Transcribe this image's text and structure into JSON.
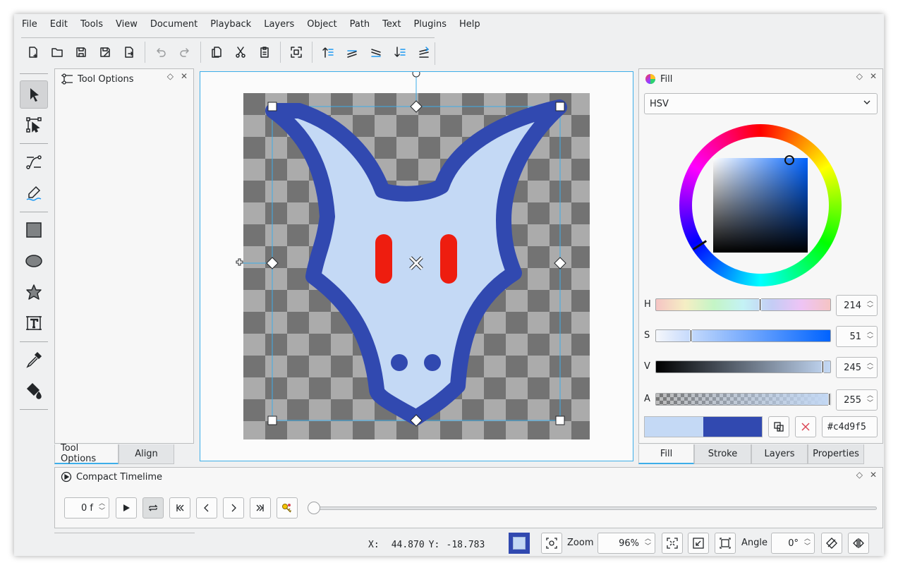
{
  "menu": [
    "File",
    "Edit",
    "Tools",
    "View",
    "Document",
    "Playback",
    "Layers",
    "Object",
    "Path",
    "Text",
    "Plugins",
    "Help"
  ],
  "toolbar_icons": [
    "new-document-icon",
    "open-icon",
    "save-icon",
    "save-as-icon",
    "export-icon",
    "undo-icon",
    "redo-icon",
    "copy-icon",
    "cut-icon",
    "paste-icon",
    "group-icon",
    "raise-to-top-icon",
    "raise-icon",
    "lower-icon",
    "lower-to-bottom-icon",
    "move-to-layer-icon"
  ],
  "tool_options": {
    "title": "Tool Options",
    "tabs": [
      "Tool Options",
      "Align"
    ]
  },
  "fill_panel": {
    "title": "Fill",
    "mode": "HSV",
    "hue_label": "H",
    "hue": "214",
    "sat_label": "S",
    "sat": "51",
    "val_label": "V",
    "val": "245",
    "alpha_label": "A",
    "alpha": "255",
    "hex": "#c4d9f5",
    "fill_color": "#c4d9f5",
    "stroke_color": "#3149b0",
    "tabs": [
      "Fill",
      "Stroke",
      "Layers",
      "Properties"
    ]
  },
  "timeline": {
    "title": "Compact Timelime",
    "frame": "0 f"
  },
  "status": {
    "x_label": "X:",
    "x": "44.870",
    "y_label": "Y:",
    "y": "-18.783",
    "zoom_label": "Zoom",
    "zoom": "96%",
    "angle_label": "Angle",
    "angle": "0°"
  },
  "colors": {
    "accent": "#3daee9",
    "fill": "#c4d9f5",
    "stroke": "#3149b0",
    "eyes": "#ee1d0f"
  }
}
